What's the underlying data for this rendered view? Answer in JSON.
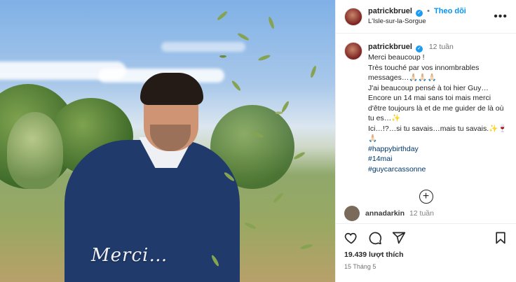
{
  "post": {
    "overlay_text": "Merci…"
  },
  "header": {
    "username": "patrickbruel",
    "verified_mark": "✓",
    "separator": "•",
    "follow_label": "Theo dõi",
    "location": "L'Isle-sur-la-Sorgue",
    "more_icon": "more-horizontal-icon"
  },
  "caption": {
    "username": "patrickbruel",
    "time": "12 tuần",
    "lines": [
      "Merci beaucoup !",
      "Très touché par vos innombrables messages…🙏🏻🙏🏻🙏🏻",
      "J'ai beaucoup pensé à toi hier Guy…",
      "Encore un 14 mai sans toi mais merci d'être toujours là et de me guider de là où tu es…✨",
      "Ici…!?…si tu savais…mais tu savais.✨🍷",
      "🙏🏻"
    ],
    "hashtags": [
      "#happybirthday",
      "#14mai",
      "#guycarcassonne"
    ]
  },
  "next_comment": {
    "username": "annadarkin",
    "time": "12 tuần"
  },
  "actions": {
    "like_icon": "heart-icon",
    "comment_icon": "comment-icon",
    "share_icon": "share-icon",
    "save_icon": "bookmark-icon",
    "load_more_icon": "plus-circle-icon"
  },
  "stats": {
    "likes": "19.439 lượt thích",
    "date": "15 Tháng 5"
  },
  "colors": {
    "link": "#0095f6",
    "hashtag": "#00376b",
    "verified": "#1d9bf0"
  }
}
